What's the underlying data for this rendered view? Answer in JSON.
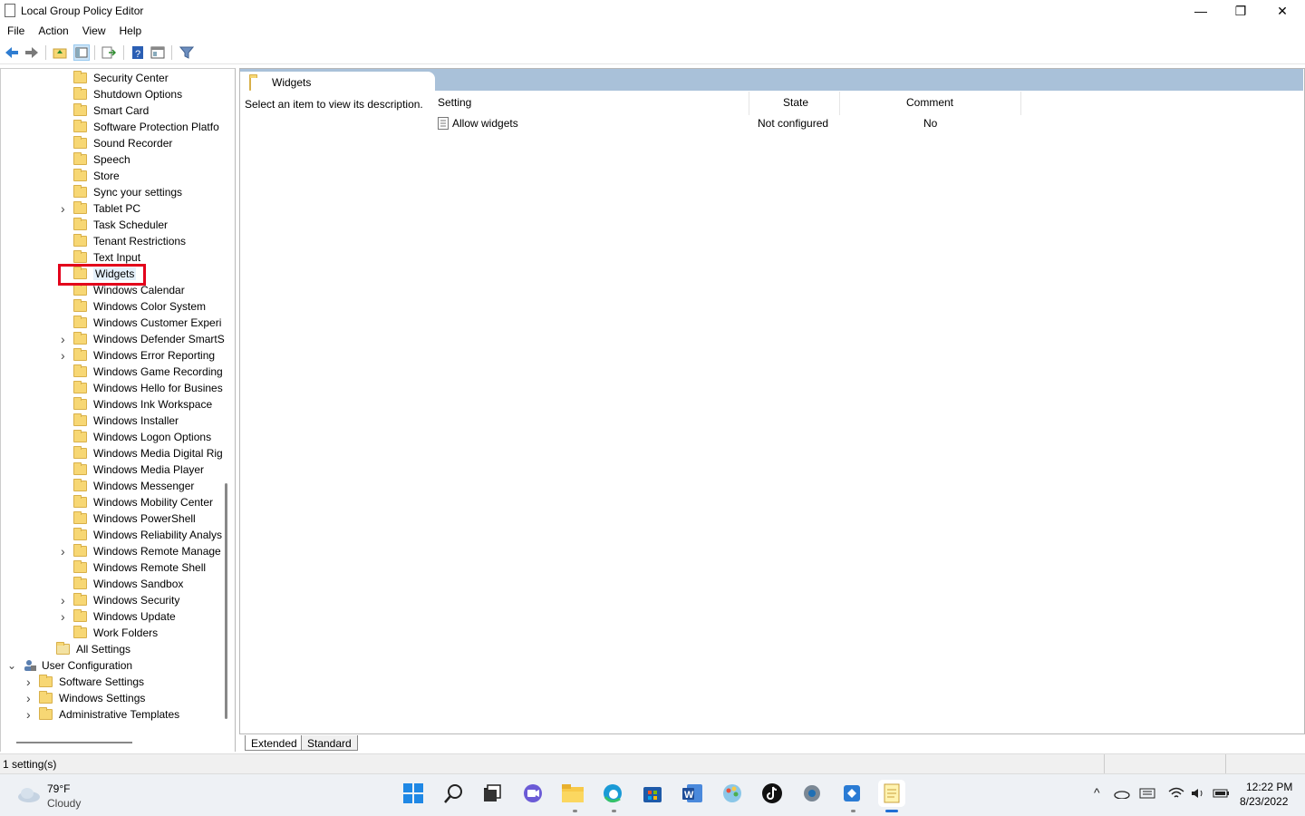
{
  "window": {
    "title": "Local Group Policy Editor",
    "minimize": "—",
    "maximize": "❐",
    "close": "✕"
  },
  "menu": [
    "File",
    "Action",
    "View",
    "Help"
  ],
  "tree": {
    "items": [
      {
        "label": "Security Center",
        "expandable": false
      },
      {
        "label": "Shutdown Options",
        "expandable": false
      },
      {
        "label": "Smart Card",
        "expandable": false
      },
      {
        "label": "Software Protection Platfo",
        "expandable": false
      },
      {
        "label": "Sound Recorder",
        "expandable": false
      },
      {
        "label": "Speech",
        "expandable": false
      },
      {
        "label": "Store",
        "expandable": false
      },
      {
        "label": "Sync your settings",
        "expandable": false
      },
      {
        "label": "Tablet PC",
        "expandable": true
      },
      {
        "label": "Task Scheduler",
        "expandable": false
      },
      {
        "label": "Tenant Restrictions",
        "expandable": false
      },
      {
        "label": "Text Input",
        "expandable": false
      },
      {
        "label": "Widgets",
        "expandable": false
      },
      {
        "label": "Windows Calendar",
        "expandable": false
      },
      {
        "label": "Windows Color System",
        "expandable": false
      },
      {
        "label": "Windows Customer Experi",
        "expandable": false
      },
      {
        "label": "Windows Defender SmartS",
        "expandable": true
      },
      {
        "label": "Windows Error Reporting",
        "expandable": true
      },
      {
        "label": "Windows Game Recording",
        "expandable": false
      },
      {
        "label": "Windows Hello for Busines",
        "expandable": false
      },
      {
        "label": "Windows Ink Workspace",
        "expandable": false
      },
      {
        "label": "Windows Installer",
        "expandable": false
      },
      {
        "label": "Windows Logon Options",
        "expandable": false
      },
      {
        "label": "Windows Media Digital Rig",
        "expandable": false
      },
      {
        "label": "Windows Media Player",
        "expandable": false
      },
      {
        "label": "Windows Messenger",
        "expandable": false
      },
      {
        "label": "Windows Mobility Center",
        "expandable": false
      },
      {
        "label": "Windows PowerShell",
        "expandable": false
      },
      {
        "label": "Windows Reliability Analys",
        "expandable": false
      },
      {
        "label": "Windows Remote Manage",
        "expandable": true
      },
      {
        "label": "Windows Remote Shell",
        "expandable": false
      },
      {
        "label": "Windows Sandbox",
        "expandable": false
      },
      {
        "label": "Windows Security",
        "expandable": true
      },
      {
        "label": "Windows Update",
        "expandable": true
      },
      {
        "label": "Work Folders",
        "expandable": false
      }
    ],
    "all_settings": "All Settings",
    "user_config": "User Configuration",
    "user_children": [
      "Software Settings",
      "Windows Settings",
      "Administrative Templates"
    ],
    "selected": "Widgets"
  },
  "content": {
    "header": "Widgets",
    "description": "Select an item to view its description.",
    "columns": [
      "Setting",
      "State",
      "Comment"
    ],
    "rows": [
      {
        "setting": "Allow widgets",
        "state": "Not configured",
        "comment": "No"
      }
    ]
  },
  "tabs": [
    "Extended",
    "Standard"
  ],
  "status": "1 setting(s)",
  "taskbar": {
    "weather_temp": "79°F",
    "weather_desc": "Cloudy",
    "time": "12:22 PM",
    "date": "8/23/2022",
    "apps": [
      "start-icon",
      "search-icon",
      "task-view-icon",
      "chat-icon",
      "file-explorer-icon",
      "edge-icon",
      "store-icon",
      "word-icon",
      "paint-icon",
      "tiktok-icon",
      "settings-icon",
      "devtools-icon",
      "notepad-icon"
    ]
  }
}
